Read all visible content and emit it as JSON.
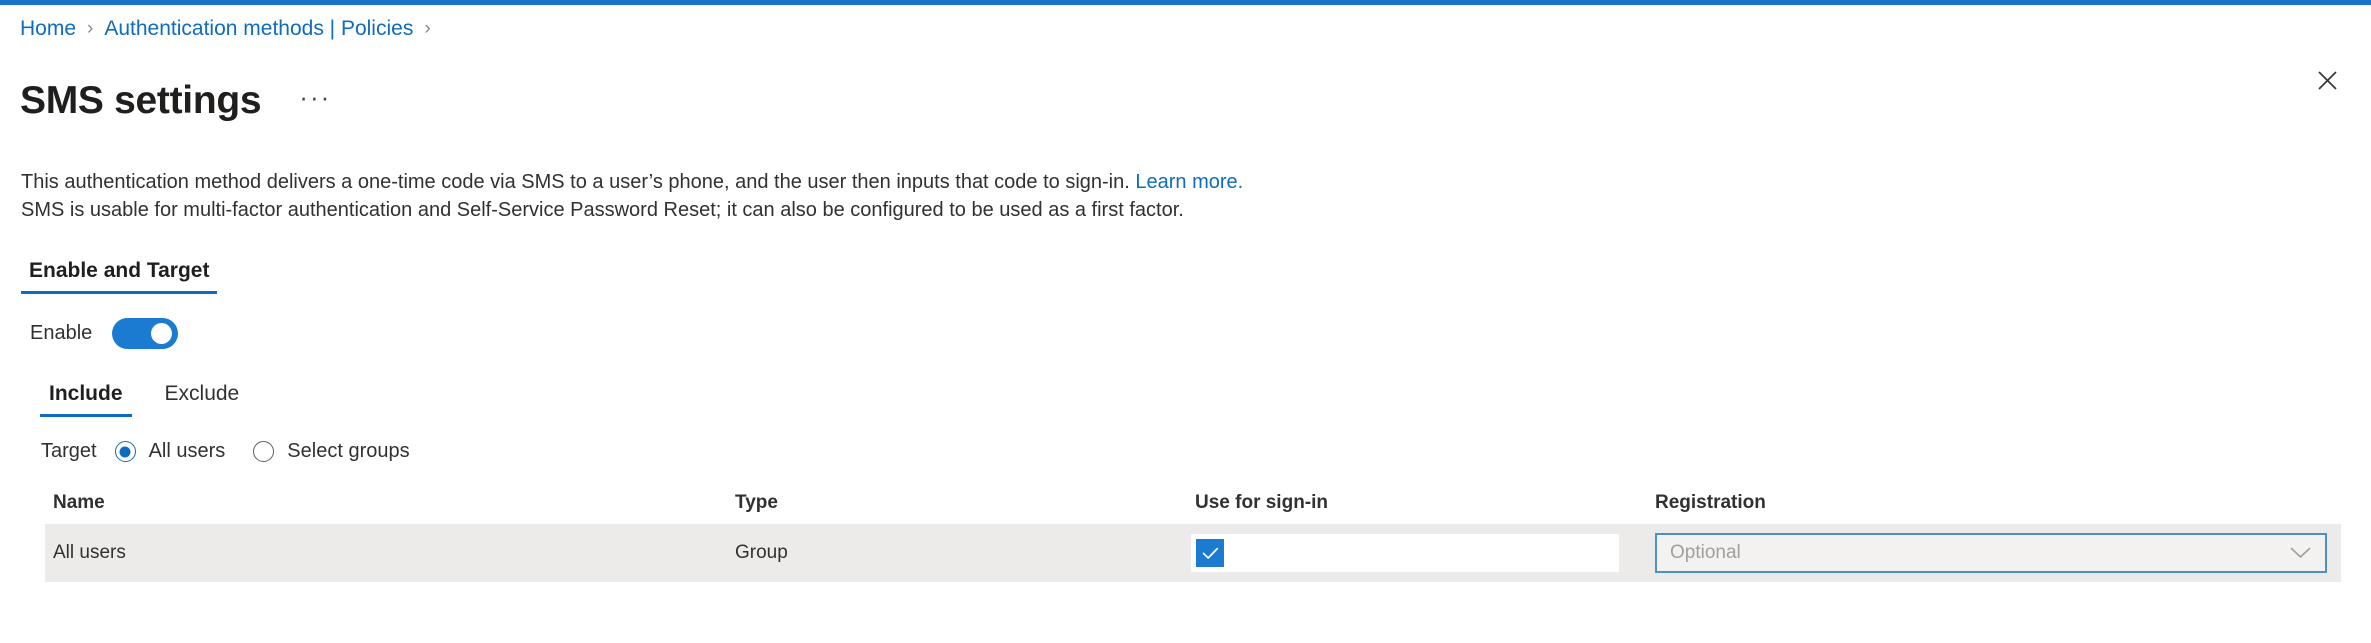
{
  "accent_color": "#1a73c8",
  "breadcrumb": {
    "items": [
      {
        "label": "Home"
      },
      {
        "label": "Authentication methods | Policies"
      }
    ],
    "separator": "›"
  },
  "header": {
    "title": "SMS settings",
    "more_options": "···",
    "close_label": "Close"
  },
  "description": {
    "line1_before_link": "This authentication method delivers a one-time code via SMS to a user’s phone, and the user then inputs that code to sign-in. ",
    "link_text": "Learn more.",
    "line2": "SMS is usable for multi-factor authentication and Self-Service Password Reset; it can also be configured to be used as a first factor."
  },
  "pivot_main": {
    "tabs": [
      {
        "label": "Enable and Target",
        "active": true
      }
    ]
  },
  "enable": {
    "label": "Enable",
    "state": "on",
    "color": "#1a7bd0"
  },
  "pivot_sub": {
    "tabs": [
      {
        "label": "Include",
        "active": true
      },
      {
        "label": "Exclude",
        "active": false
      }
    ]
  },
  "target": {
    "label": "Target",
    "options": [
      {
        "label": "All users",
        "selected": true
      },
      {
        "label": "Select groups",
        "selected": false
      }
    ]
  },
  "table": {
    "columns": [
      {
        "key": "name",
        "label": "Name"
      },
      {
        "key": "type",
        "label": "Type"
      },
      {
        "key": "sign_in",
        "label": "Use for sign-in"
      },
      {
        "key": "registration",
        "label": "Registration"
      }
    ],
    "rows": [
      {
        "name": "All users",
        "type": "Group",
        "sign_in_checked": true,
        "registration_value": "Optional"
      }
    ]
  }
}
